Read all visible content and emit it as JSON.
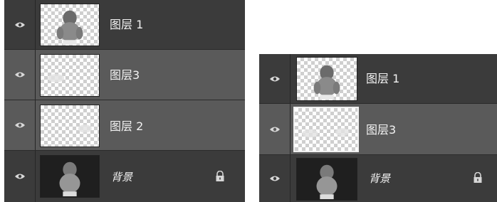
{
  "left_panel": {
    "layers": [
      {
        "name": "图层 1",
        "thumb": "baby-cutout",
        "visible": true,
        "selected": false
      },
      {
        "name": "图层3",
        "thumb": "faint-shape-left",
        "visible": true,
        "selected": true
      },
      {
        "name": "图层 2",
        "thumb": "faint-shape-right",
        "visible": true,
        "selected": true
      },
      {
        "name": "背景",
        "thumb": "baby-photo",
        "visible": true,
        "selected": false,
        "locked": true
      }
    ]
  },
  "right_panel": {
    "layers": [
      {
        "name": "图层 1",
        "thumb": "baby-cutout",
        "visible": true,
        "selected": false
      },
      {
        "name": "图层3",
        "thumb": "faint-shapes-both",
        "visible": true,
        "selected": true,
        "mask_active": true
      },
      {
        "name": "背景",
        "thumb": "baby-photo",
        "visible": true,
        "selected": false,
        "locked": true
      }
    ]
  },
  "icons": {
    "visibility": "eye-icon",
    "lock": "lock-icon"
  },
  "colors": {
    "panel": "#3a3a3a",
    "row": "#444444",
    "selected_row": "#5a5a5a",
    "text": "#f2f2f2"
  }
}
